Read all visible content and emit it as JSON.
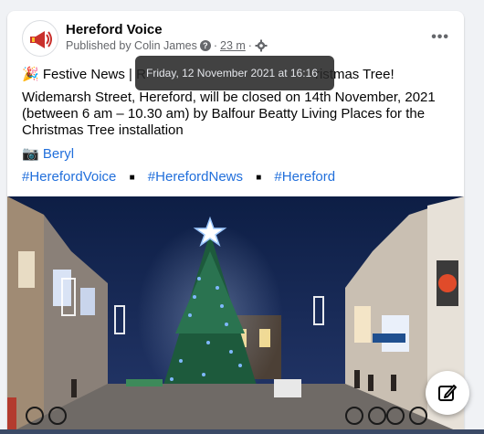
{
  "post": {
    "page_name": "Hereford Voice",
    "meta": {
      "published_by": "Published by Colin James",
      "time": "23 m",
      "dot": "·"
    },
    "title_emoji": "🎉",
    "title_visible_start": "Festive News | R",
    "title_visible_end": "ristmas Tree!",
    "body": "Widemarsh Street, Hereford, will be closed on 14th November, 2021 (between 6 am – 10.30 am) by Balfour Beatty Living Places for the Christmas Tree installation",
    "photo_credit_icon": "📷",
    "photo_credit": "Beryl",
    "hashtags": [
      "#HerefordVoice",
      "#HerefordNews",
      "#Hereford"
    ],
    "hashtag_separator": "■"
  },
  "tooltip": {
    "text": "Friday, 12 November 2021 at 16:16"
  },
  "icons": {
    "more": "more-options-icon",
    "help": "help-icon",
    "settings": "gear-icon",
    "compose": "compose-icon"
  },
  "colors": {
    "link": "#216fdb",
    "secondary_text": "#65676b",
    "photo_sky": "#13244a"
  }
}
